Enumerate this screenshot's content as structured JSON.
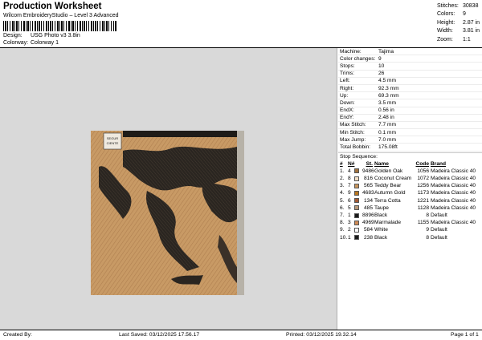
{
  "header": {
    "title": "Production Worksheet",
    "subtitle": "Wilcom EmbroideryStudio – Level 3 Advanced",
    "design_label": "Design:",
    "design_value": "USG Photo v3 3.8in",
    "colorway_label": "Colorway:",
    "colorway_value": "Colorway 1"
  },
  "stats": [
    {
      "label": "Stitches:",
      "value": "30838"
    },
    {
      "label": "Colors:",
      "value": "9"
    },
    {
      "label": "Height:",
      "value": "2.87 in"
    },
    {
      "label": "Width:",
      "value": "3.81 in"
    },
    {
      "label": "Zoom:",
      "value": "1:1"
    }
  ],
  "machine_info": [
    {
      "label": "Machine:",
      "value": "Tajima"
    },
    {
      "label": "Color changes:",
      "value": "9"
    },
    {
      "label": "Stops:",
      "value": "10"
    },
    {
      "label": "Trims:",
      "value": "26"
    },
    {
      "label": "Left:",
      "value": "4.5 mm"
    },
    {
      "label": "Right:",
      "value": "92.3 mm"
    },
    {
      "label": "Up:",
      "value": "69.3 mm"
    },
    {
      "label": "Down:",
      "value": "3.5 mm"
    },
    {
      "label": "EndX:",
      "value": "0.56 in"
    },
    {
      "label": "EndY:",
      "value": "2.48 in"
    },
    {
      "label": "Max Stitch:",
      "value": "7.7 mm"
    },
    {
      "label": "Min Stitch:",
      "value": "0.1 mm"
    },
    {
      "label": "Max Jump:",
      "value": "7.0 mm"
    },
    {
      "label": "Total Bobbin:",
      "value": "175.08ft"
    }
  ],
  "stop_sequence": {
    "title": "Stop Sequence:",
    "headers": {
      "idx": "#",
      "n": "N#",
      "st": "St.",
      "name": "Name",
      "code": "Code",
      "brand": "Brand"
    },
    "rows": [
      {
        "idx": "1.",
        "n": "4",
        "color": "#a0713c",
        "st": "9486",
        "name": "Golden Oak",
        "code": "1056",
        "brand": "Madeira Classic 40"
      },
      {
        "idx": "2.",
        "n": "8",
        "color": "#f3dfc6",
        "st": "816",
        "name": "Coconut Cream",
        "code": "1072",
        "brand": "Madeira Classic 40"
      },
      {
        "idx": "3.",
        "n": "7",
        "color": "#c8955c",
        "st": "565",
        "name": "Teddy Bear",
        "code": "1256",
        "brand": "Madeira Classic 40"
      },
      {
        "idx": "4.",
        "n": "9",
        "color": "#b8751f",
        "st": "4683",
        "name": "Autumn Gold",
        "code": "1173",
        "brand": "Madeira Classic 40"
      },
      {
        "idx": "5.",
        "n": "6",
        "color": "#a35a33",
        "st": "134",
        "name": "Terra Cotta",
        "code": "1221",
        "brand": "Madeira Classic 40"
      },
      {
        "idx": "6.",
        "n": "5",
        "color": "#b89878",
        "st": "485",
        "name": "Taupe",
        "code": "1128",
        "brand": "Madeira Classic 40"
      },
      {
        "idx": "7.",
        "n": "1",
        "color": "#1a1a1a",
        "st": "8896",
        "name": "Black",
        "code": "8",
        "brand": "Default"
      },
      {
        "idx": "8.",
        "n": "3",
        "color": "#cf8a55",
        "st": "4969",
        "name": "Marmalade",
        "code": "1155",
        "brand": "Madeira Classic 40"
      },
      {
        "idx": "9.",
        "n": "2",
        "color": "#ffffff",
        "st": "584",
        "name": "White",
        "code": "9",
        "brand": "Default"
      },
      {
        "idx": "10.",
        "n": "1",
        "color": "#1a1a1a",
        "st": "238",
        "name": "Black",
        "code": "8",
        "brand": "Default"
      }
    ]
  },
  "design_preview": {
    "patch_text_line1": "SEGUR",
    "patch_text_line2": "CIENTE"
  },
  "footer": {
    "created_by": "Created By:",
    "last_saved": "Last Saved: 03/12/2025 17.56.17",
    "printed": "Printed: 03/12/2025 19.32.14",
    "page": "Page 1 of 1"
  },
  "colors": {
    "design_background": "#d9d9d9",
    "fabric": "#c89a65",
    "dark_stitch": "#2a2520"
  }
}
